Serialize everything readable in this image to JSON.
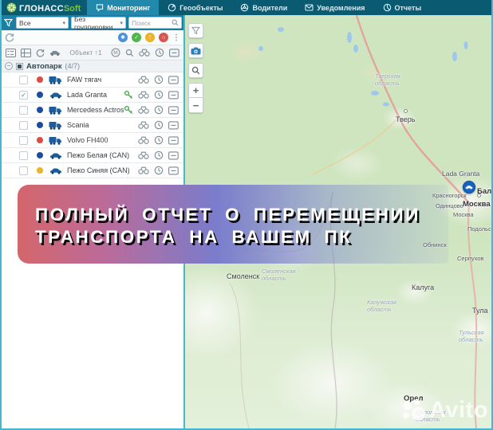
{
  "topbar": {
    "logo": {
      "main": "ГЛОНАСС",
      "accent": "Soft"
    },
    "nav": [
      {
        "label": "Мониторинг"
      },
      {
        "label": "Геообъекты"
      },
      {
        "label": "Водители"
      },
      {
        "label": "Уведомления"
      },
      {
        "label": "Отчеты"
      }
    ]
  },
  "panel": {
    "filters": {
      "all": "Все",
      "grouping": "Без группировки",
      "search_placeholder": "Поиск"
    },
    "toolbar": {
      "sort_label": "Объект ↑1"
    },
    "status_filters": [
      {
        "name": "moving",
        "color": "#4a90d9",
        "glyph": "✱"
      },
      {
        "name": "ok",
        "color": "#52b54b",
        "glyph": "✓"
      },
      {
        "name": "idle",
        "color": "#efb02a",
        "glyph": "!"
      },
      {
        "name": "stopped",
        "color": "#d9534f",
        "glyph": "○"
      }
    ],
    "group": {
      "name": "Автопарк",
      "count": "(4/7)"
    },
    "vehicles": [
      {
        "name": "FAW тягач",
        "status": "red",
        "type": "truck",
        "checked": false,
        "has_key": false
      },
      {
        "name": "Lada Granta",
        "status": "blue",
        "type": "car",
        "checked": true,
        "has_key": true
      },
      {
        "name": "Mercedess Actros",
        "status": "blue",
        "type": "truck",
        "checked": false,
        "has_key": true
      },
      {
        "name": "Scania",
        "status": "blue",
        "type": "truck",
        "checked": false,
        "has_key": false
      },
      {
        "name": "Volvo FH400",
        "status": "red",
        "type": "truck",
        "checked": false,
        "has_key": false
      },
      {
        "name": "Пежо Белая (CAN)",
        "status": "blue",
        "type": "car",
        "checked": false,
        "has_key": false
      },
      {
        "name": "Пежо Синяя (CAN)",
        "status": "yellow",
        "type": "car",
        "checked": false,
        "has_key": false
      }
    ],
    "status_colors": {
      "red": "#e04b3f",
      "blue": "#1a4d9e",
      "yellow": "#efb02a"
    }
  },
  "map": {
    "zoom_in": "+",
    "zoom_out": "−",
    "marker": {
      "label": "Lada Granta"
    },
    "labels": [
      {
        "text": "Тверская\nобласть"
      },
      {
        "text": "Тверь"
      },
      {
        "text": "Красногорск"
      },
      {
        "text": "Бала"
      },
      {
        "text": "Москва"
      },
      {
        "text": "Одинцово"
      },
      {
        "text": "Москва"
      },
      {
        "text": "Подольск"
      },
      {
        "text": "Обнинск"
      },
      {
        "text": "Серпухов"
      },
      {
        "text": "Смоленск"
      },
      {
        "text": "Смоленская\nобласть"
      },
      {
        "text": "Калуга"
      },
      {
        "text": "Калужская\nобласть"
      },
      {
        "text": "Тула"
      },
      {
        "text": "Тульская\nобласть"
      },
      {
        "text": "Орел"
      },
      {
        "text": "Орловская\nобласть"
      }
    ],
    "watermark": "Avito"
  },
  "banner": {
    "line1": "ПОЛНЫЙ ОТЧЕТ О ПЕРЕМЕЩЕНИИ",
    "line2": "ТРАНСПОРТА НА ВАШЕМ ПК"
  },
  "colors": {
    "topbar": "#0a5a72",
    "active_tab": "#2289ac",
    "accent_green": "#7dc242",
    "frame_teal": "#45b7cf",
    "marker_blue": "#1565c0",
    "banner_red": "#d4666b",
    "banner_blue": "#7a7ccc"
  }
}
